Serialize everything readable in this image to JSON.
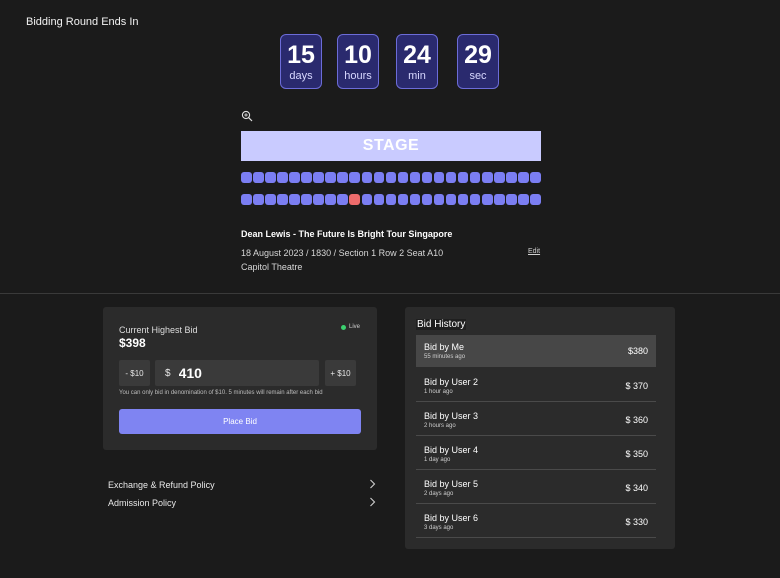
{
  "countdown": {
    "title": "Bidding Round Ends In",
    "units": [
      {
        "value": "15",
        "label": "days"
      },
      {
        "value": "10",
        "label": "hours"
      },
      {
        "value": "24",
        "label": "min"
      },
      {
        "value": "29",
        "label": "sec"
      }
    ]
  },
  "seatmap": {
    "zoom_icon": "zoom-in-icon",
    "stage_label": "STAGE",
    "rows": 2,
    "seats_per_row": 25,
    "selected": {
      "row": 2,
      "seat": 10
    },
    "colors": {
      "available": "#7b7ef2",
      "selected": "#ee6c6c",
      "stage": "#c9cbff"
    }
  },
  "event": {
    "title": "Dean Lewis - The Future Is Bright Tour Singapore",
    "details": "18 August 2023 / 1830 / Section 1 Row 2 Seat A10",
    "venue": "Capitol Theatre",
    "edit_label": "Edit"
  },
  "bid": {
    "current_label": "Current Highest Bid",
    "current_value": "$398",
    "live_label": "Live",
    "decrement_label": "- $10",
    "increment_label": "+ $10",
    "currency": "$",
    "input_value": "410",
    "hint": "You can only bid in denomination of $10. 5 minutes will remain after each bid",
    "place_label": "Place Bid",
    "accent": "#7f84f2"
  },
  "policies": [
    {
      "label": "Exchange & Refund Policy"
    },
    {
      "label": "Admission Policy"
    }
  ],
  "history": {
    "title": "Bid History",
    "items": [
      {
        "name": "Bid by Me",
        "time": "55 minutes ago",
        "amount": "$380"
      },
      {
        "name": "Bid by User 2",
        "time": "1 hour ago",
        "amount": "$ 370"
      },
      {
        "name": "Bid by User 3",
        "time": "2 hours ago",
        "amount": "$ 360"
      },
      {
        "name": "Bid by User 4",
        "time": "1 day ago",
        "amount": "$ 350"
      },
      {
        "name": "Bid by User 5",
        "time": "2 days ago",
        "amount": "$ 340"
      },
      {
        "name": "Bid by User 6",
        "time": "3 days ago",
        "amount": "$ 330"
      }
    ]
  }
}
